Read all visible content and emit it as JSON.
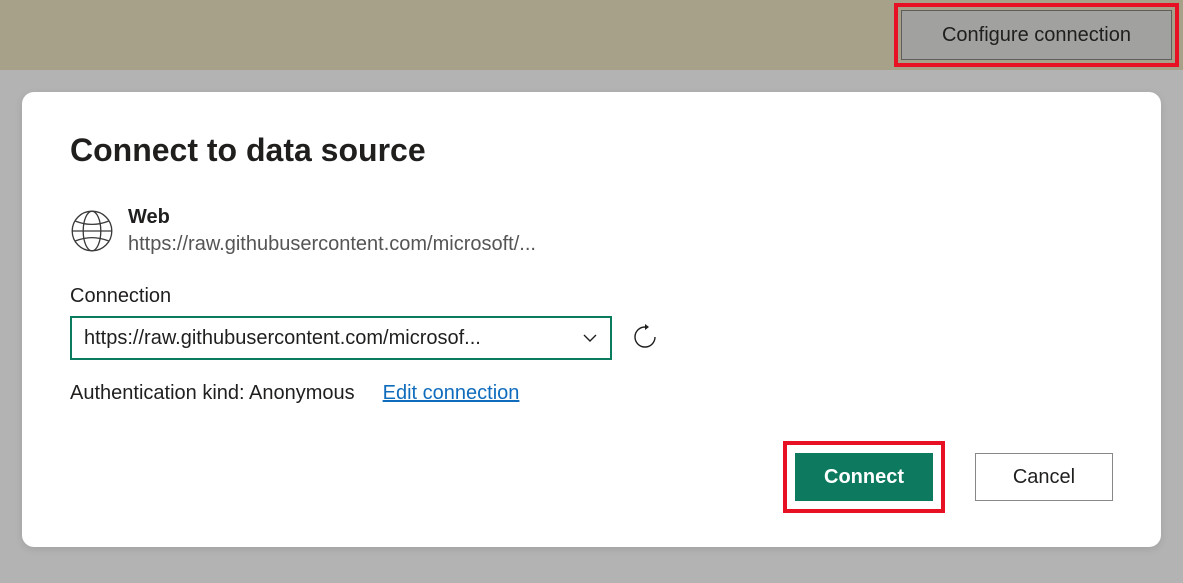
{
  "topbar": {
    "configure_label": "Configure connection"
  },
  "dialog": {
    "title": "Connect to data source",
    "source": {
      "type_label": "Web",
      "url_display": "https://raw.githubusercontent.com/microsoft/..."
    },
    "connection": {
      "label": "Connection",
      "selected_value": "https://raw.githubusercontent.com/microsof..."
    },
    "auth": {
      "kind_text": "Authentication kind: Anonymous",
      "edit_link_label": "Edit connection"
    },
    "buttons": {
      "connect_label": "Connect",
      "cancel_label": "Cancel"
    }
  }
}
